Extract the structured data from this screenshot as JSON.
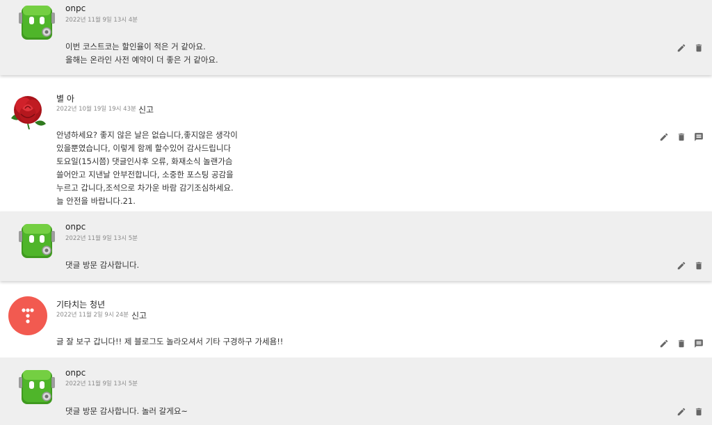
{
  "comments": [
    {
      "type": "reply",
      "author": "onpc",
      "date": "2022년 11월 9일 13시 4분",
      "body": "이번 코스트코는 할인율이 적은 거 같아요.\n올해는 온라인 사전 예약이 더 좋은 거 같아요.",
      "icons": [
        "edit-icon",
        "delete-icon"
      ]
    },
    {
      "type": "comment",
      "author": "별 아",
      "date": "2022년 10월 19일 19시 43분",
      "report": "신고",
      "body": "안녕하세요? 좋지 않은 날은 없습니다,좋지않은 생각이\n있을뿐였습니다, 이렇게 함께 할수있어 감사드립니다\n토요일(15시쯤) 댓글인사후 오류, 화재소식 놀랜가슴\n쓸어안고 지낸날 안부전합니다, 소중한 포스팅 공감을\n누르고 갑니다,조석으로 차가운 바람 감기조심하세요.\n늘 안전을 바랍니다.21.",
      "icons": [
        "edit-icon",
        "delete-icon",
        "reply-icon"
      ]
    },
    {
      "type": "reply",
      "author": "onpc",
      "date": "2022년 11월 9일 13시 5분",
      "body": "댓글 방문 감사합니다.",
      "icons": [
        "edit-icon",
        "delete-icon"
      ]
    },
    {
      "type": "comment",
      "author": "기타치는 청년",
      "date": "2022년 11월 2일 9시 24분",
      "report": "신고",
      "body": "글 잘 보구 갑니다!! 제 블로그도 놀라오셔서 기타 구경하구 가세욤!!",
      "icons": [
        "edit-icon",
        "delete-icon",
        "reply-icon"
      ]
    },
    {
      "type": "reply",
      "author": "onpc",
      "date": "2022년 11월 9일 13시 5분",
      "body": "댓글 방문 감사합니다. 놀러 갈게요~",
      "icons": [
        "edit-icon",
        "delete-icon"
      ]
    }
  ],
  "colors": {
    "reply_bg": "#efefef",
    "icon": "#666666",
    "robot_green": "#4fb52a",
    "guitar_avatar": "#f25a50",
    "rose": "#c61b1b"
  }
}
